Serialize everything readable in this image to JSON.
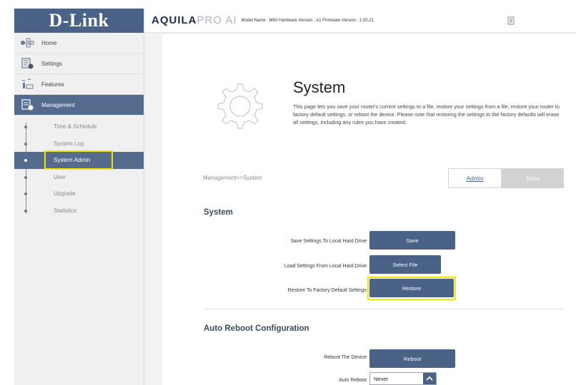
{
  "sidebar": {
    "logo": "D-Link",
    "items": [
      {
        "label": "Home",
        "icon": "home-network-icon"
      },
      {
        "label": "Settings",
        "icon": "settings-icon"
      },
      {
        "label": "Features",
        "icon": "features-icon"
      },
      {
        "label": "Management",
        "icon": "management-icon"
      }
    ],
    "subitems": [
      {
        "label": "Time & Schedule"
      },
      {
        "label": "System Log"
      },
      {
        "label": "System Admin"
      },
      {
        "label": "User"
      },
      {
        "label": "Upgrade"
      },
      {
        "label": "Statistics"
      }
    ]
  },
  "header": {
    "brand_bold": "AQUILA",
    "brand_light": "PRO AI",
    "info": "Model Name : M60 Hardware Version : A1 Firmware Version : 1.00.21",
    "icon": "document-icon"
  },
  "main": {
    "title": "System",
    "description": "This page lets you save your router's current settings to a file, restore your settings from a file, restore your router to factory default settings, or reboot the device. Please note that restoring the settings to the factory defaults will erase all settings, including any rules you have created.",
    "breadcrumb": "Management>>System",
    "admin_tab": "Admin",
    "save_button": "Save",
    "system_section": {
      "title": "System",
      "rows": [
        {
          "label": "Save Settings To Local Hard Drive",
          "button": "Save"
        },
        {
          "label": "Load Settings From Local Hard Drive",
          "button": "Select File"
        },
        {
          "label": "Restore To Factory Default Settings",
          "button": "Restore"
        }
      ]
    },
    "auto_reboot_section": {
      "title": "Auto Reboot Configuration",
      "reboot_label": "Reboot The Device",
      "reboot_button": "Reboot",
      "auto_label": "Auto Reboot",
      "auto_value": "Never"
    }
  },
  "colors": {
    "primary": "#4a6286",
    "active_nav": "#546b8e",
    "highlight": "#f2e600"
  }
}
